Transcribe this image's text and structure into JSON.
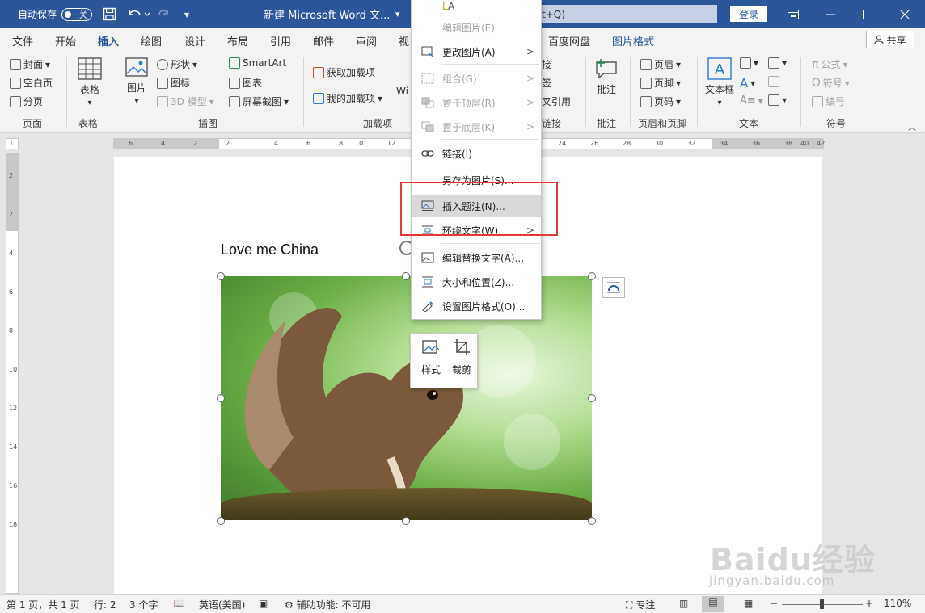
{
  "titlebar": {
    "autosave_label": "自动保存",
    "autosave_state": "关",
    "doc_title": "新建 Microsoft Word 文...",
    "search_suffix": "t+Q)",
    "login": "登录"
  },
  "tabs": [
    "文件",
    "开始",
    "插入",
    "绘图",
    "设计",
    "布局",
    "引用",
    "邮件",
    "审阅",
    "视",
    "百度网盘",
    "图片格式"
  ],
  "share": "共享",
  "ribbon": {
    "pages": {
      "cover": "封面",
      "blank": "空白页",
      "break": "分页",
      "group": "页面"
    },
    "table": {
      "label": "表格",
      "group": "表格"
    },
    "illus": {
      "picture": "图片",
      "shapes": "形状",
      "icons": "图标",
      "model3d": "3D 模型",
      "smartart": "SmartArt",
      "chart": "图表",
      "screenshot": "屏幕截图",
      "group": "插图"
    },
    "addins": {
      "get": "获取加载项",
      "mine": "我的加载项",
      "wi": "Wi",
      "group": "加载项"
    },
    "links": {
      "l1": "接",
      "l2": "签",
      "l3": "叉引用",
      "group": "链接"
    },
    "comments": {
      "label": "批注",
      "group": "批注"
    },
    "headerfooter": {
      "header": "页眉",
      "footer": "页脚",
      "pagenum": "页码",
      "group": "页眉和页脚"
    },
    "text": {
      "textbox": "文本框",
      "group": "文本"
    },
    "symbols": {
      "equation": "公式",
      "symbol": "符号",
      "numbering": "编号",
      "group": "符号"
    }
  },
  "context_menu": {
    "top_partial": "A",
    "edit_picture": "编辑图片(E)",
    "change_picture": "更改图片(A)",
    "group": "组合(G)",
    "bring_front": "置于顶层(R)",
    "send_back": "置于底层(K)",
    "link": "链接(I)",
    "save_as_picture": "另存为图片(S)...",
    "insert_caption": "插入题注(N)...",
    "wrap_text": "环绕文字(W)",
    "edit_alt_text": "编辑替换文字(A)...",
    "size_position": "大小和位置(Z)...",
    "format_picture": "设置图片格式(O)..."
  },
  "mini_toolbar": {
    "style": "样式",
    "crop": "裁剪"
  },
  "document": {
    "text": "Love me China"
  },
  "ruler_h": [
    "6",
    "4",
    "2",
    "2",
    "4",
    "6",
    "8",
    "10",
    "12",
    "24",
    "26",
    "28",
    "30",
    "32",
    "34",
    "36",
    "38",
    "40",
    "42"
  ],
  "ruler_v": [
    "2",
    "2",
    "4",
    "6",
    "8",
    "10",
    "12",
    "14",
    "16",
    "18"
  ],
  "statusbar": {
    "page": "第 1 页，共 1 页",
    "row": "行: 2",
    "words": "3 个字",
    "language": "英语(美国)",
    "accessibility": "辅助功能: 不可用",
    "focus": "专注",
    "zoom": "110%"
  },
  "watermark": {
    "text": "Baidu经验",
    "sub": "jingyan.baidu.com"
  },
  "colors": {
    "accent": "#2b579a",
    "highlight_box": "#e53935"
  }
}
